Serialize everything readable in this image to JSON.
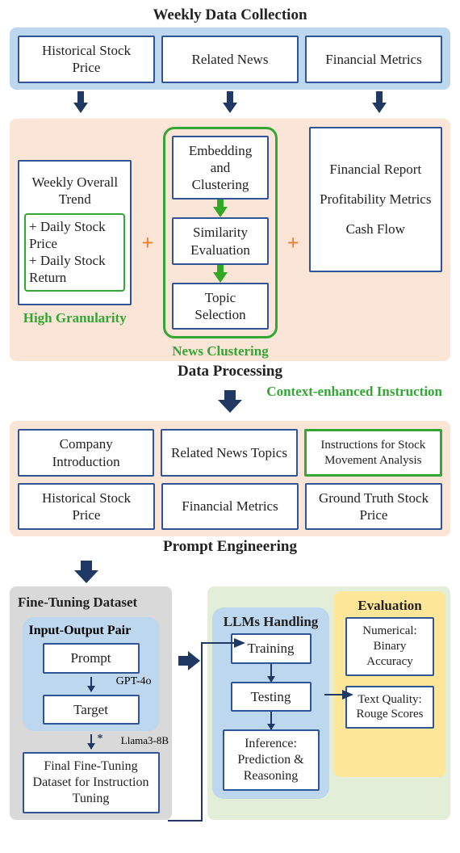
{
  "titles": {
    "weekly_data": "Weekly Data Collection",
    "data_processing": "Data Processing",
    "prompt_eng": "Prompt Engineering",
    "fine_tuning": "Fine-Tuning Dataset",
    "llm_handling": "LLMs Handling",
    "evaluation": "Evaluation",
    "input_output": "Input-Output Pair"
  },
  "collection": {
    "hist_price": "Historical Stock Price",
    "related_news": "Related News",
    "fin_metrics": "Financial Metrics"
  },
  "processing": {
    "trend": "Weekly Overall Trend",
    "daily_price": "+ Daily Stock Price",
    "daily_return": "+ Daily Stock Return",
    "high_granularity": "High Granularity",
    "embed": "Embedding and Clustering",
    "sim_eval": "Similarity Evaluation",
    "topic_sel": "Topic Selection",
    "news_clustering": "News Clustering",
    "fin_report": "Financial Report",
    "prof_metrics": "Profitability Metrics",
    "cash_flow": "Cash Flow",
    "context_enhanced": "Context-enhanced Instruction"
  },
  "prompt": {
    "company_intro": "Company Introduction",
    "related_topics": "Related News Topics",
    "instructions": "Instructions for Stock Movement Analysis",
    "hist_price": "Historical Stock Price",
    "fin_metrics": "Financial Metrics",
    "gt_stock": "Ground Truth Stock Price"
  },
  "ft": {
    "prompt": "Prompt",
    "target": "Target",
    "gpt": "GPT-4o",
    "llama": "Llama3-8B",
    "final": "Final Fine-Tuning Dataset for Instruction Tuning",
    "star": "*"
  },
  "llm": {
    "train": "Training",
    "test": "Testing",
    "infer": "Inference: Prediction & Reasoning"
  },
  "eval": {
    "numerical": "Numerical: Binary Accuracy",
    "text": "Text Quality: Rouge Scores"
  },
  "symbols": {
    "plus": "+"
  }
}
